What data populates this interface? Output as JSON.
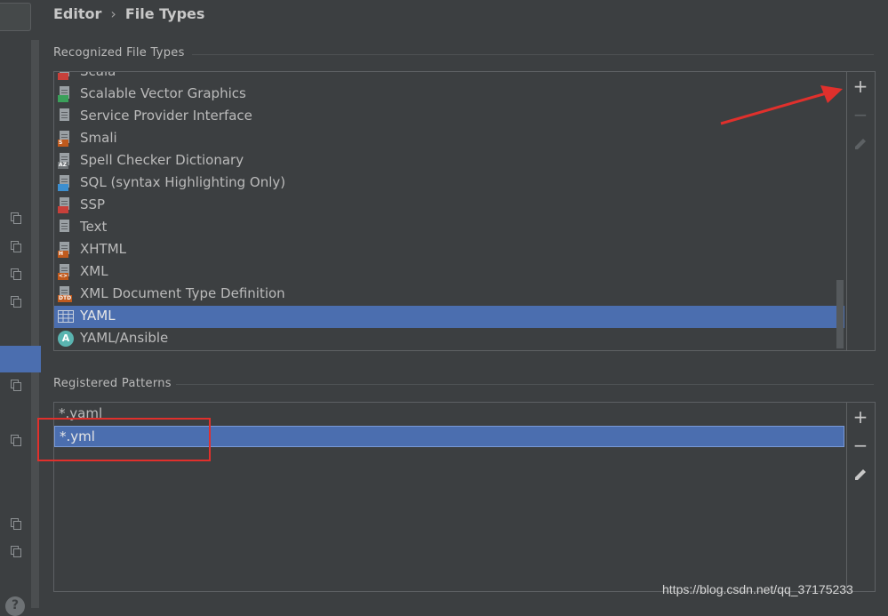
{
  "breadcrumb": {
    "parent": "Editor",
    "current": "File Types"
  },
  "recognized": {
    "title": "Recognized File Types",
    "items": [
      {
        "label": "Scala",
        "icon": "scala-file-icon",
        "badge": "",
        "badge_color": "#c7403a"
      },
      {
        "label": "Scalable Vector Graphics",
        "icon": "svg-file-icon",
        "badge": "",
        "badge_color": "#3aa05a"
      },
      {
        "label": "Service Provider Interface",
        "icon": "text-file-icon",
        "badge": "",
        "badge_color": ""
      },
      {
        "label": "Smali",
        "icon": "smali-file-icon",
        "badge": "S",
        "badge_color": "#c05a1d"
      },
      {
        "label": "Spell Checker Dictionary",
        "icon": "dictionary-file-icon",
        "badge": "AZ",
        "badge_color": "#6d7275"
      },
      {
        "label": "SQL (syntax Highlighting Only)",
        "icon": "sql-file-icon",
        "badge": "",
        "badge_color": "#3c8fd0"
      },
      {
        "label": "SSP",
        "icon": "ssp-file-icon",
        "badge": "",
        "badge_color": "#c7403a"
      },
      {
        "label": "Text",
        "icon": "text-file-icon",
        "badge": "",
        "badge_color": ""
      },
      {
        "label": "XHTML",
        "icon": "xhtml-file-icon",
        "badge": "H",
        "badge_color": "#c05a1d"
      },
      {
        "label": "XML",
        "icon": "xml-file-icon",
        "badge": "<>",
        "badge_color": "#c05a1d"
      },
      {
        "label": "XML Document Type Definition",
        "icon": "dtd-file-icon",
        "badge": "DTD",
        "badge_color": "#c05a1d"
      },
      {
        "label": "YAML",
        "icon": "yaml-table-icon",
        "badge": "",
        "badge_color": "",
        "selected": true
      },
      {
        "label": "YAML/Ansible",
        "icon": "ansible-icon",
        "badge": "A",
        "badge_color": "#5ab4b0"
      }
    ]
  },
  "patterns": {
    "title": "Registered Patterns",
    "items": [
      {
        "label": "*.yaml"
      },
      {
        "label": "*.yml",
        "selected": true
      }
    ]
  },
  "buttons": {
    "add": "+",
    "remove": "−"
  },
  "watermark": "https://blog.csdn.net/qq_37175233",
  "colors": {
    "selection": "#4b6eaf",
    "annotation": "#e0302c",
    "background": "#3c3f41"
  }
}
